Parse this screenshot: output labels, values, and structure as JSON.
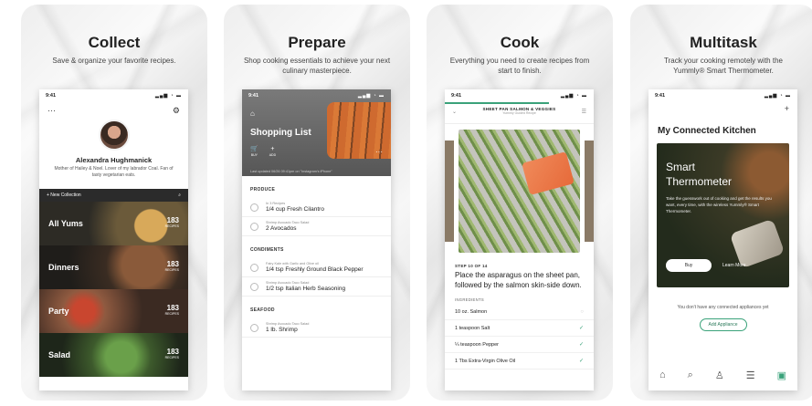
{
  "panels": {
    "collect": {
      "title": "Collect",
      "subtitle": "Save & organize your favorite recipes.",
      "time": "9:41",
      "menu_icon": "ellipsis-icon",
      "settings_icon": "gear-icon",
      "name": "Alexandra Hughmanick",
      "bio": "Mother of Hailey & Noel. Lover of my labrador Coal. Fan of tasty vegetarian eats.",
      "new_collection": "+ New Collection",
      "search_glyph": "⌕",
      "collections": [
        {
          "label": "All Yums",
          "count": "183",
          "unit": "RECIPES"
        },
        {
          "label": "Dinners",
          "count": "183",
          "unit": "RECIPES"
        },
        {
          "label": "Party",
          "count": "183",
          "unit": "RECIPES"
        },
        {
          "label": "Salad",
          "count": "183",
          "unit": "RECIPES"
        }
      ]
    },
    "prepare": {
      "title": "Prepare",
      "subtitle": "Shop cooking essentials to achieve your next culinary masterpiece.",
      "time": "9:41",
      "list_title": "Shopping List",
      "buy_label": "BUY",
      "add_label": "ADD",
      "buy_badge": "3",
      "updated": "Last updated 06/26 09:41pm on \"Instagram's iPhone\"",
      "sections": [
        {
          "name": "PRODUCE",
          "items": [
            {
              "source": "In 3 Recipes",
              "item": "1/4 cup Fresh Cilantro"
            },
            {
              "source": "Shrimp Avocado Taco Salad",
              "item": "2 Avocados"
            }
          ]
        },
        {
          "name": "CONDIMENTS",
          "items": [
            {
              "source": "Fairy Kale with Garlic and Olive oil",
              "item": "1/4 tsp Freshly Ground Black Pepper"
            },
            {
              "source": "Shrimp Avocado Taco Salad",
              "item": "1/2 tsp Italian Herb Seasoning"
            }
          ]
        },
        {
          "name": "SEAFOOD",
          "items": [
            {
              "source": "Shrimp Avocado Taco Salad",
              "item": "1 lb. Shrimp"
            }
          ]
        }
      ]
    },
    "cook": {
      "title": "Cook",
      "subtitle": "Everything you need to create recipes from start to finish.",
      "time": "9:41",
      "recipe": "SHEET PAN SALMON & VEGGIES",
      "recipe_sub": "Yummly Guided Recipe",
      "step": "STEP 10 OF 14",
      "instruction": "Place the asparagus on the sheet pan, followed by the salmon skin-side down.",
      "ingredients_label": "INGREDIENTS",
      "ingredients": [
        {
          "name": "10 oz. Salmon",
          "checked": false
        },
        {
          "name": "1 teaspoon Salt",
          "checked": true
        },
        {
          "name": "¼ teaspoon Pepper",
          "checked": true
        },
        {
          "name": "1 Tbs Extra-Virgin Olive Oil",
          "checked": true
        }
      ]
    },
    "multitask": {
      "title": "Multitask",
      "subtitle": "Track your cooking remotely with the Yummly® Smart Thermometer.",
      "time": "9:41",
      "heading": "My Connected Kitchen",
      "tile_title_1": "Smart",
      "tile_title_2": "Thermometer",
      "tile_desc": "Take the guesswork out of cooking and get the results you want, every time, with the wireless Yummly® Smart Thermometer.",
      "buy": "Buy",
      "learn": "Learn More",
      "empty_text": "You don't have any connected appliances yet",
      "add_appliance": "Add Appliance",
      "nav_icons": [
        "home-icon",
        "search-icon",
        "profile-icon",
        "list-icon",
        "devices-icon"
      ]
    }
  }
}
